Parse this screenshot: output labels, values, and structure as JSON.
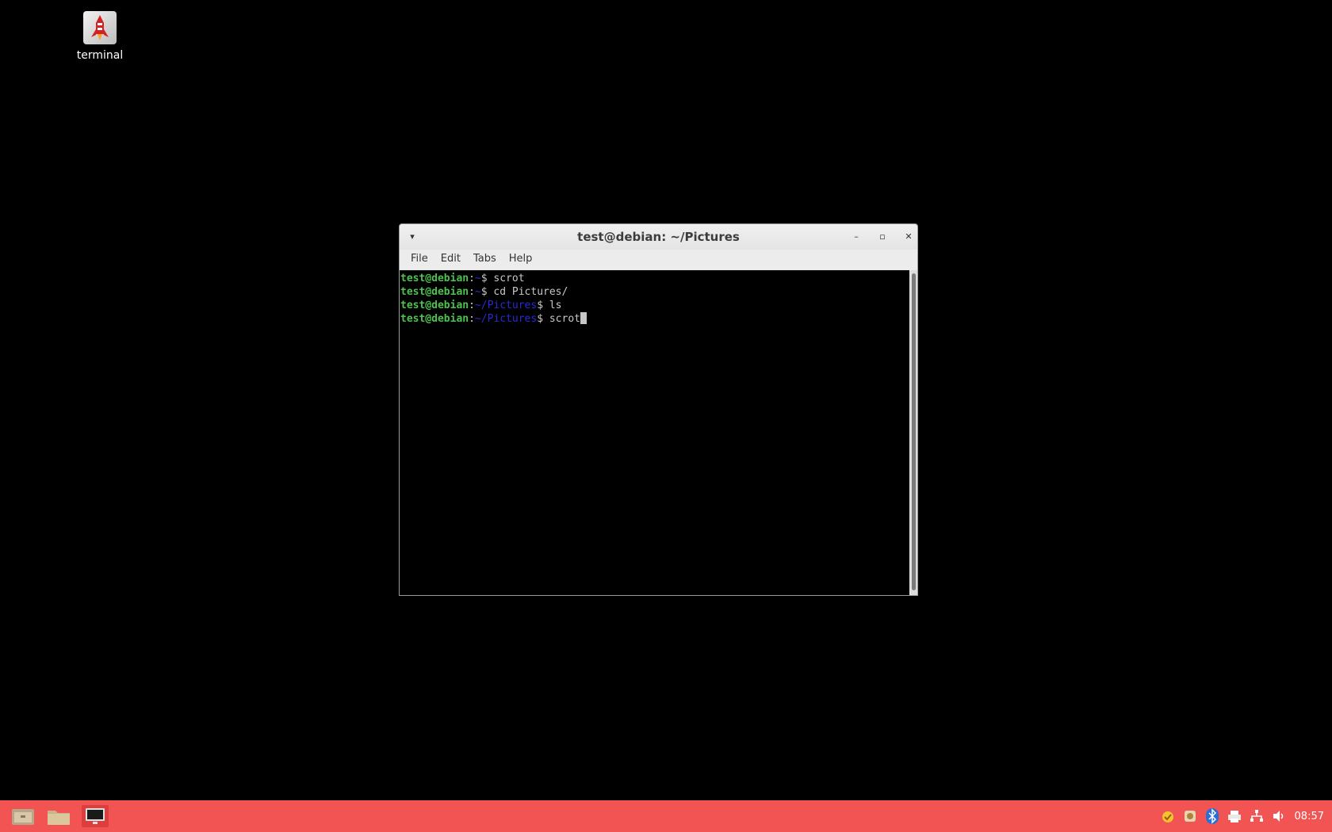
{
  "desktop": {
    "icons": [
      {
        "label": "terminal",
        "icon": "rocket-icon"
      }
    ]
  },
  "window": {
    "title": "test@debian: ~/Pictures",
    "menu": [
      "File",
      "Edit",
      "Tabs",
      "Help"
    ],
    "lines": [
      {
        "user": "test@debian",
        "path": "~",
        "command": "scrot"
      },
      {
        "user": "test@debian",
        "path": "~",
        "command": "cd Pictures/"
      },
      {
        "user": "test@debian",
        "path": "~/Pictures",
        "command": "ls"
      },
      {
        "user": "test@debian",
        "path": "~/Pictures",
        "command": "scrot"
      }
    ]
  },
  "taskbar": {
    "launchers": [
      "file-cabinet-icon",
      "folder-icon",
      "terminal-icon"
    ],
    "tray": [
      "update-icon",
      "cloud-icon",
      "bluetooth-icon",
      "printer-icon",
      "network-icon",
      "volume-icon"
    ],
    "clock": "08:57"
  },
  "colors": {
    "taskbar": "#f25454",
    "prompt_user": "#4ec24e",
    "prompt_path": "#2a2ad4"
  }
}
